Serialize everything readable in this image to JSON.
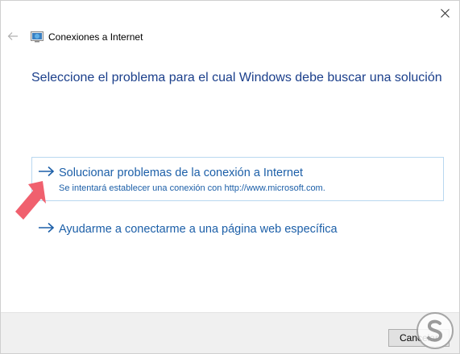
{
  "window": {
    "title": "Conexiones a Internet",
    "close_icon": "close-icon",
    "back_icon": "back-arrow-icon"
  },
  "main": {
    "heading": "Seleccione el problema para el cual Windows debe buscar una solución",
    "options": [
      {
        "title": "Solucionar problemas de la conexión a Internet",
        "subtitle": "Se intentará establecer una conexión con http://www.microsoft.com.",
        "icon": "arrow-right-icon",
        "selected": true
      },
      {
        "title": "Ayudarme a conectarme a una página web específica",
        "icon": "arrow-right-icon",
        "selected": false
      }
    ]
  },
  "footer": {
    "cancel_label": "Cancelar"
  },
  "colors": {
    "heading": "#1b3f8b",
    "link": "#1c5fa8",
    "selected_border": "#b9d8f0",
    "annotation_arrow": "#f0606e",
    "footer_bg": "#f0f0f0"
  }
}
